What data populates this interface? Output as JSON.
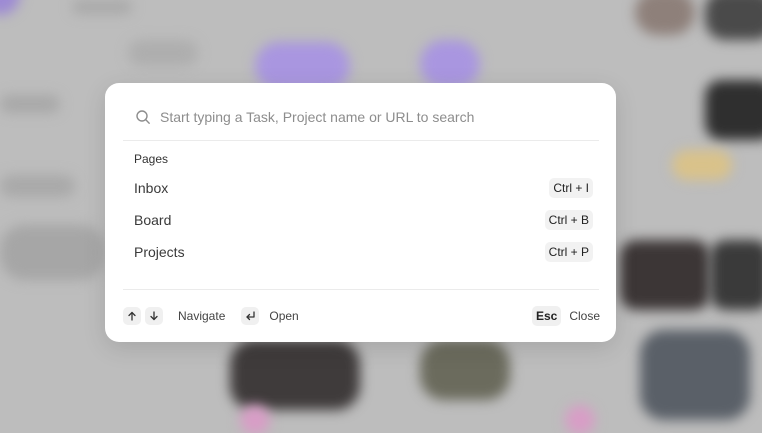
{
  "search": {
    "placeholder": "Start typing a Task, Project name or URL to search"
  },
  "section": {
    "label": "Pages"
  },
  "pages": [
    {
      "label": "Inbox",
      "shortcut": "Ctrl + I"
    },
    {
      "label": "Board",
      "shortcut": "Ctrl + B"
    },
    {
      "label": "Projects",
      "shortcut": "Ctrl + P"
    }
  ],
  "footer": {
    "navigate_label": "Navigate",
    "open_label": "Open",
    "esc_key": "Esc",
    "close_label": "Close"
  },
  "icons": {
    "search": "search-icon",
    "up": "arrow-up-icon",
    "down": "arrow-down-icon",
    "enter": "enter-icon"
  }
}
